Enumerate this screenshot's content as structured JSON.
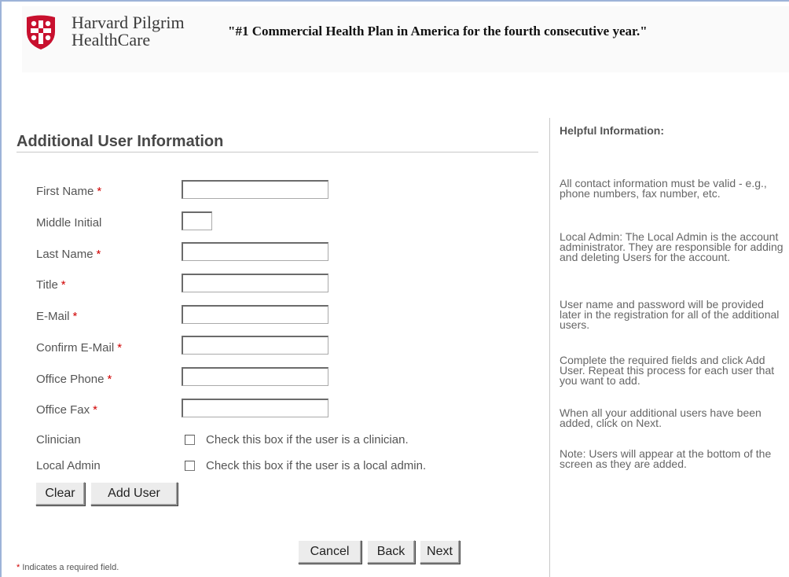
{
  "header": {
    "brand_line1": "Harvard Pilgrim",
    "brand_line2": "HealthCare",
    "tagline": "\"#1 Commercial Health Plan in America for the fourth consecutive year.\"",
    "brand_color": "#c8102e"
  },
  "form": {
    "title": "Additional User Information",
    "required_marker": "*",
    "fields": [
      {
        "label": "First Name",
        "required": true,
        "value": ""
      },
      {
        "label": "Middle Initial",
        "required": false,
        "value": ""
      },
      {
        "label": "Last Name",
        "required": true,
        "value": ""
      },
      {
        "label": "Title",
        "required": true,
        "value": ""
      },
      {
        "label": "E-Mail",
        "required": true,
        "value": ""
      },
      {
        "label": "Confirm E-Mail",
        "required": true,
        "value": ""
      },
      {
        "label": "Office Phone",
        "required": true,
        "value": ""
      },
      {
        "label": "Office Fax",
        "required": true,
        "value": ""
      }
    ],
    "clinician": {
      "label": "Clinician",
      "text": "Check this box if the user is a clinician.",
      "checked": false
    },
    "local_admin": {
      "label": "Local Admin",
      "text": "Check this box if the user is a local admin.",
      "checked": false
    },
    "clear_label": "Clear",
    "add_user_label": "Add User",
    "cancel_label": "Cancel",
    "back_label": "Back",
    "next_label": "Next",
    "required_note": "Indicates a required field."
  },
  "help": {
    "title": "Helpful Information:",
    "p1": "All contact information must be valid - e.g., phone numbers, fax number, etc.",
    "p2": "Local Admin: The Local Admin is the account administrator. They are responsible for adding and deleting Users for the account.",
    "p3": "User name and password will be provided later in the registration for all of the additional users.",
    "p4": "Complete the required fields and click Add User. Repeat this process for each user that you want to add.",
    "p5": "When all your additional users have been added, click on Next.",
    "p6": "Note: Users will appear at the bottom of the screen as they are added."
  }
}
